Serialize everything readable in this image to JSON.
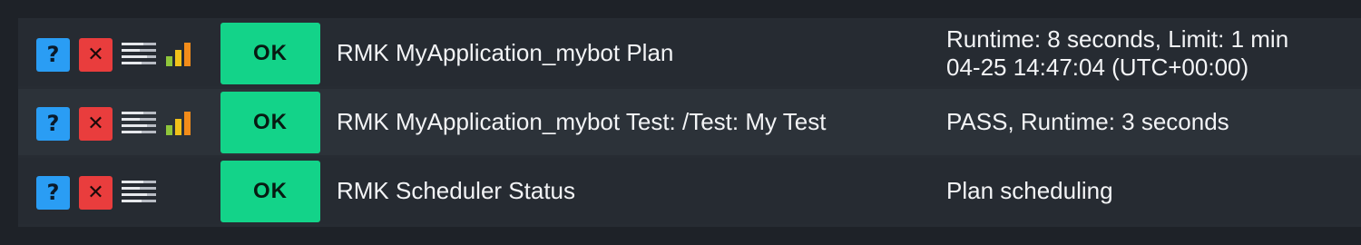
{
  "colors": {
    "background": "#1e2228",
    "row_dark": "#262b32",
    "row_light": "#2c3239",
    "ok_green": "#13d389",
    "help_blue": "#2a9df4",
    "delete_red": "#e93d3d",
    "text": "#f3f4f6"
  },
  "icons": {
    "help": "?",
    "delete": "✕",
    "menu": "menu-lines-icon",
    "perf": "bar-chart-icon"
  },
  "services": [
    {
      "state": "OK",
      "name": "RMK MyApplication_mybot Plan",
      "output_line1": "Runtime: 8 seconds, Limit: 1 min",
      "output_line2": "04-25 14:47:04 (UTC+00:00)",
      "has_perf": true
    },
    {
      "state": "OK",
      "name": "RMK MyApplication_mybot Test: /Test: My Test",
      "output_line1": "PASS, Runtime: 3 seconds",
      "output_line2": "",
      "has_perf": true
    },
    {
      "state": "OK",
      "name": "RMK Scheduler Status",
      "output_line1": "Plan scheduling",
      "output_line2": "",
      "has_perf": false
    }
  ]
}
